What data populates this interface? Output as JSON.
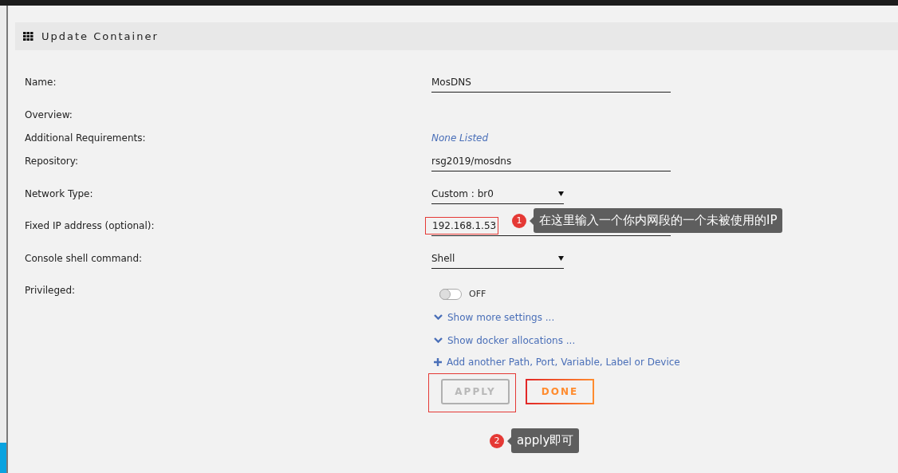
{
  "header": {
    "title": "Update Container"
  },
  "fields": [
    {
      "label": "Name:",
      "kind": "text",
      "value": "MosDNS",
      "highlighted": false
    },
    {
      "label": "Overview:",
      "kind": "static"
    },
    {
      "label": "Additional Requirements:",
      "kind": "note",
      "value": "None Listed"
    },
    {
      "label": "Repository:",
      "kind": "text",
      "value": "rsg2019/mosdns",
      "highlighted": false
    },
    {
      "label": "Network Type:",
      "kind": "select",
      "value": "Custom : br0"
    },
    {
      "label": "Fixed IP address (optional):",
      "kind": "text",
      "value": "192.168.1.53",
      "highlighted": true
    },
    {
      "label": "Console shell command:",
      "kind": "select",
      "value": "Shell"
    },
    {
      "label": "Privileged:",
      "kind": "toggle",
      "on": false,
      "state_label": "OFF"
    }
  ],
  "links": [
    {
      "kind": "expand",
      "label": "Show more settings ..."
    },
    {
      "kind": "expand",
      "label": "Show docker allocations ..."
    },
    {
      "kind": "add",
      "label": "Add another Path, Port, Variable, Label or Device"
    }
  ],
  "buttons": [
    {
      "kind": "apply",
      "label": "APPLY",
      "highlighted": true
    },
    {
      "kind": "done",
      "label": "DONE",
      "highlighted": false
    }
  ],
  "annotations": [
    {
      "number": "1",
      "text": "在这里输入一个你内网段的一个未被使用的IP"
    },
    {
      "number": "2",
      "text": "apply即可"
    }
  ]
}
